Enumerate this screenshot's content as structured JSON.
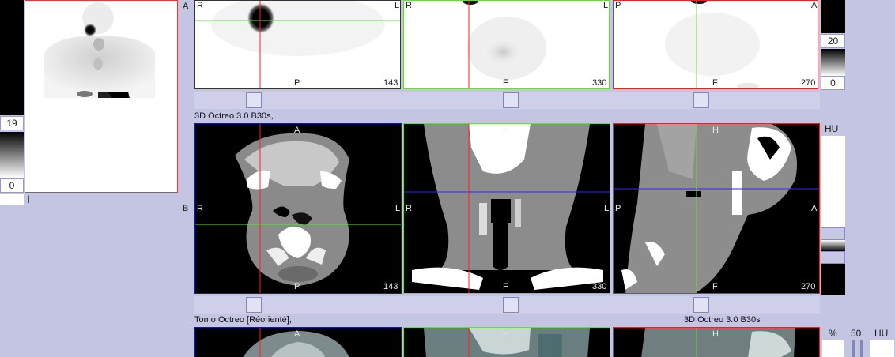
{
  "left_strip": {
    "top_value": "19",
    "bottom_value": "0",
    "tiny_marker": "|"
  },
  "mip": {
    "marker_a": "A",
    "marker_b": "B"
  },
  "row1": {
    "panels": [
      {
        "id": "transverse",
        "left": "R",
        "right": "L",
        "bottom": "P",
        "slice": "143"
      },
      {
        "id": "coronal",
        "left": "R",
        "right": "L",
        "bottom": "F",
        "slice": "330"
      },
      {
        "id": "sagittal",
        "left": "P",
        "right": "A",
        "bottom": "F",
        "slice": "270"
      }
    ],
    "scale": {
      "top_value": "20",
      "bottom_value": "0"
    }
  },
  "row2": {
    "series_title": "3D Octreo  3.0  B30s,",
    "panels": [
      {
        "id": "ct-transverse",
        "top": "A",
        "left": "R",
        "right": "L",
        "bottom": "P",
        "slice": "143"
      },
      {
        "id": "ct-coronal",
        "top": "H",
        "left": "R",
        "right": "L",
        "bottom": "F",
        "slice": "330"
      },
      {
        "id": "ct-sagittal",
        "top": "H",
        "left": "P",
        "right": "A",
        "bottom": "F",
        "slice": "270"
      }
    ],
    "scale_unit": "HU"
  },
  "row3": {
    "series_title": "Tomo Octreo [Réorienté],",
    "series_title_right": "3D Octreo  3.0  B30s",
    "panels": [
      {
        "id": "fused-transverse",
        "top": "A"
      },
      {
        "id": "fused-coronal",
        "top": "H"
      },
      {
        "id": "fused-sagittal",
        "top": "H"
      }
    ],
    "blend": {
      "percent_label": "%",
      "value": "50",
      "unit": "HU"
    }
  },
  "colors": {
    "background": "#c4c4e3",
    "crosshair_red": "#ff2020",
    "crosshair_green": "#66dd44",
    "crosshair_blue": "#2a2aff",
    "frame_blue": "#1a1a88",
    "frame_green": "#77d055",
    "frame_red": "#c83030"
  }
}
